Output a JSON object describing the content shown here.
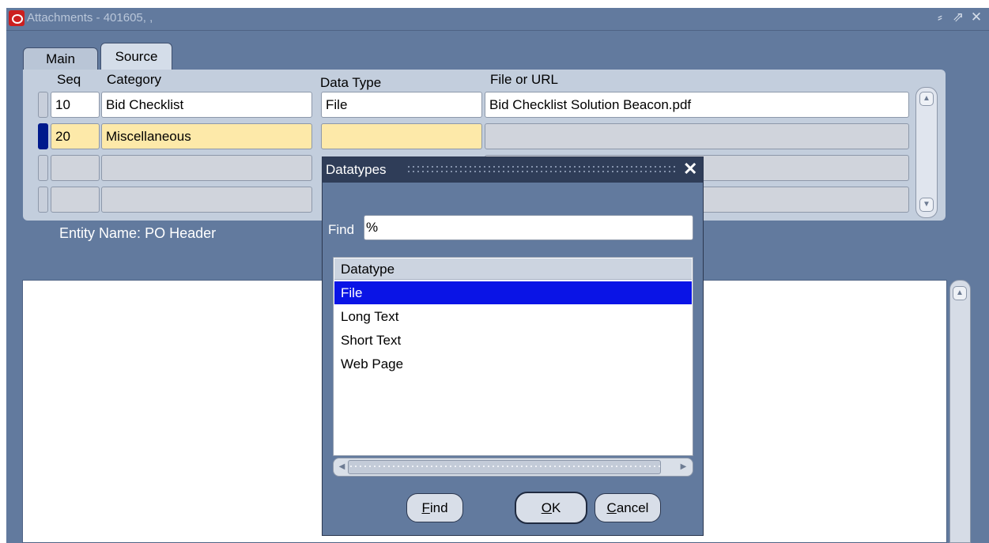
{
  "window": {
    "title": "Attachments - 401605, ,",
    "controls": {
      "minimize": "⸗",
      "restore": "⇗",
      "close": "✕"
    }
  },
  "tabs": [
    {
      "label": "Main"
    },
    {
      "label": "Source"
    }
  ],
  "grid": {
    "headers": {
      "seq": "Seq",
      "category": "Category",
      "data_type": "Data Type",
      "file_or_url": "File or URL"
    },
    "rows": [
      {
        "seq": "10",
        "category": "Bid Checklist",
        "data_type": "File",
        "file_or_url": "Bid Checklist Solution Beacon.pdf"
      },
      {
        "seq": "20",
        "category": "Miscellaneous",
        "data_type": "",
        "file_or_url": ""
      },
      {
        "seq": "",
        "category": "",
        "data_type": "",
        "file_or_url": ""
      },
      {
        "seq": "",
        "category": "",
        "data_type": "",
        "file_or_url": ""
      }
    ]
  },
  "entity": {
    "label": "Entity Name:",
    "value": "PO Header"
  },
  "dialog": {
    "title": "Datatypes",
    "find_label": "Find",
    "find_value": "%",
    "list_header": "Datatype",
    "items": [
      {
        "label": "File",
        "selected": true
      },
      {
        "label": "Long Text",
        "selected": false
      },
      {
        "label": "Short Text",
        "selected": false
      },
      {
        "label": "Web Page",
        "selected": false
      }
    ],
    "buttons": {
      "find": {
        "mnemonic": "F",
        "rest": "ind"
      },
      "ok": {
        "mnemonic": "O",
        "rest": "K"
      },
      "cancel": {
        "mnemonic": "C",
        "rest": "ancel"
      }
    }
  },
  "colors": {
    "window_bg": "#627a9e",
    "panel_bg": "#c3cedd",
    "current_record_bg": "#fde9a9",
    "selection_bg": "#0a14e6",
    "dialog_title_bg": "#2f3d58"
  }
}
